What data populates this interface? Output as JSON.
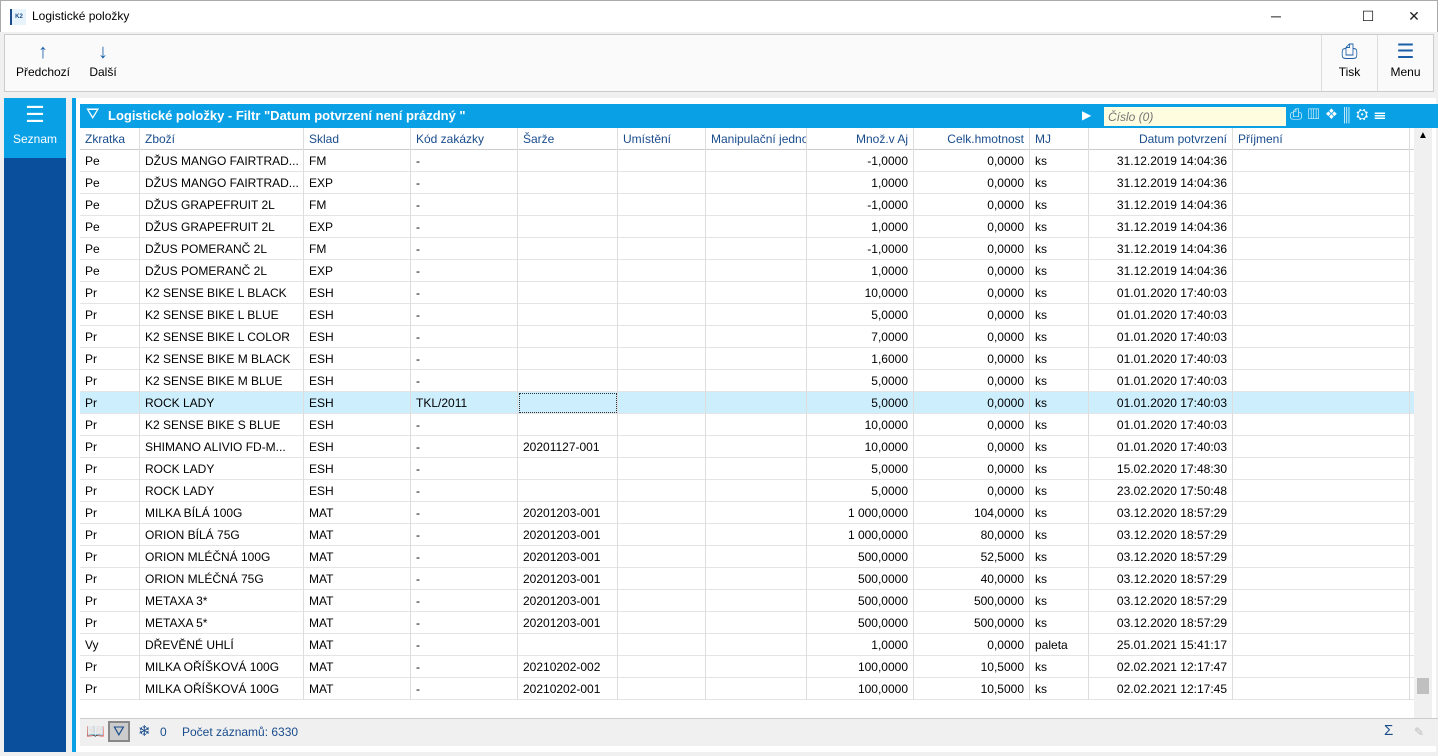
{
  "window": {
    "title": "Logistické položky",
    "logo": "K2"
  },
  "toolbar": {
    "prev": "Předchozí",
    "next": "Další",
    "print": "Tisk",
    "menu": "Menu"
  },
  "sidebar": {
    "active": "Seznam"
  },
  "panel": {
    "title": "Logistické položky - Filtr \"Datum potvrzení není prázdný \"",
    "search_placeholder": "Číslo (0)"
  },
  "columns": [
    "Zkratka",
    "Zboží",
    "Sklad",
    "Kód zakázky",
    "Šarže",
    "Umístění",
    "Manipulační jedno",
    "Množ.v Aj",
    "Celk.hmotnost",
    "MJ",
    "Datum potvrzení",
    "Příjmení"
  ],
  "rows": [
    [
      "Pe",
      "DŽUS MANGO FAIRTRAD...",
      "FM",
      "-",
      "",
      "",
      "",
      "-1,0000",
      "0,0000",
      "ks",
      "31.12.2019 14:04:36",
      ""
    ],
    [
      "Pe",
      "DŽUS MANGO FAIRTRAD...",
      "EXP",
      "-",
      "",
      "",
      "",
      "1,0000",
      "0,0000",
      "ks",
      "31.12.2019 14:04:36",
      ""
    ],
    [
      "Pe",
      "DŽUS GRAPEFRUIT 2L",
      "FM",
      "-",
      "",
      "",
      "",
      "-1,0000",
      "0,0000",
      "ks",
      "31.12.2019 14:04:36",
      ""
    ],
    [
      "Pe",
      "DŽUS GRAPEFRUIT 2L",
      "EXP",
      "-",
      "",
      "",
      "",
      "1,0000",
      "0,0000",
      "ks",
      "31.12.2019 14:04:36",
      ""
    ],
    [
      "Pe",
      "DŽUS POMERANČ 2L",
      "FM",
      "-",
      "",
      "",
      "",
      "-1,0000",
      "0,0000",
      "ks",
      "31.12.2019 14:04:36",
      ""
    ],
    [
      "Pe",
      "DŽUS POMERANČ 2L",
      "EXP",
      "-",
      "",
      "",
      "",
      "1,0000",
      "0,0000",
      "ks",
      "31.12.2019 14:04:36",
      ""
    ],
    [
      "Pr",
      "K2 SENSE BIKE L BLACK",
      "ESH",
      "-",
      "",
      "",
      "",
      "10,0000",
      "0,0000",
      "ks",
      "01.01.2020 17:40:03",
      ""
    ],
    [
      "Pr",
      "K2 SENSE BIKE L BLUE",
      "ESH",
      "-",
      "",
      "",
      "",
      "5,0000",
      "0,0000",
      "ks",
      "01.01.2020 17:40:03",
      ""
    ],
    [
      "Pr",
      "K2 SENSE BIKE L COLOR",
      "ESH",
      "-",
      "",
      "",
      "",
      "7,0000",
      "0,0000",
      "ks",
      "01.01.2020 17:40:03",
      ""
    ],
    [
      "Pr",
      "K2 SENSE BIKE M BLACK",
      "ESH",
      "-",
      "",
      "",
      "",
      "1,6000",
      "0,0000",
      "ks",
      "01.01.2020 17:40:03",
      ""
    ],
    [
      "Pr",
      "K2 SENSE BIKE M BLUE",
      "ESH",
      "-",
      "",
      "",
      "",
      "5,0000",
      "0,0000",
      "ks",
      "01.01.2020 17:40:03",
      ""
    ],
    [
      "Pr",
      "ROCK LADY",
      "ESH",
      "TKL/2011",
      "",
      "",
      "",
      "5,0000",
      "0,0000",
      "ks",
      "01.01.2020 17:40:03",
      ""
    ],
    [
      "Pr",
      "K2 SENSE BIKE S BLUE",
      "ESH",
      "-",
      "",
      "",
      "",
      "10,0000",
      "0,0000",
      "ks",
      "01.01.2020 17:40:03",
      ""
    ],
    [
      "Pr",
      "SHIMANO ALIVIO FD-M...",
      "ESH",
      "-",
      "20201127-001",
      "",
      "",
      "10,0000",
      "0,0000",
      "ks",
      "01.01.2020 17:40:03",
      ""
    ],
    [
      "Pr",
      "ROCK LADY",
      "ESH",
      "-",
      "",
      "",
      "",
      "5,0000",
      "0,0000",
      "ks",
      "15.02.2020 17:48:30",
      ""
    ],
    [
      "Pr",
      "ROCK LADY",
      "ESH",
      "-",
      "",
      "",
      "",
      "5,0000",
      "0,0000",
      "ks",
      "23.02.2020 17:50:48",
      ""
    ],
    [
      "Pr",
      "MILKA BÍLÁ 100G",
      "MAT",
      "-",
      "20201203-001",
      "",
      "",
      "1 000,0000",
      "104,0000",
      "ks",
      "03.12.2020 18:57:29",
      ""
    ],
    [
      "Pr",
      "ORION BÍLÁ 75G",
      "MAT",
      "-",
      "20201203-001",
      "",
      "",
      "1 000,0000",
      "80,0000",
      "ks",
      "03.12.2020 18:57:29",
      ""
    ],
    [
      "Pr",
      "ORION MLÉČNÁ 100G",
      "MAT",
      "-",
      "20201203-001",
      "",
      "",
      "500,0000",
      "52,5000",
      "ks",
      "03.12.2020 18:57:29",
      ""
    ],
    [
      "Pr",
      "ORION MLÉČNÁ 75G",
      "MAT",
      "-",
      "20201203-001",
      "",
      "",
      "500,0000",
      "40,0000",
      "ks",
      "03.12.2020 18:57:29",
      ""
    ],
    [
      "Pr",
      "METAXA 3*",
      "MAT",
      "-",
      "20201203-001",
      "",
      "",
      "500,0000",
      "500,0000",
      "ks",
      "03.12.2020 18:57:29",
      ""
    ],
    [
      "Pr",
      "METAXA 5*",
      "MAT",
      "-",
      "20201203-001",
      "",
      "",
      "500,0000",
      "500,0000",
      "ks",
      "03.12.2020 18:57:29",
      ""
    ],
    [
      "Vy",
      "DŘEVĚNÉ UHLÍ",
      "MAT",
      "-",
      "",
      "",
      "",
      "1,0000",
      "0,0000",
      "paleta",
      "25.01.2021 15:41:17",
      ""
    ],
    [
      "Pr",
      "MILKA OŘÍŠKOVÁ 100G",
      "MAT",
      "-",
      "20210202-002",
      "",
      "",
      "100,0000",
      "10,5000",
      "ks",
      "02.02.2021 12:17:47",
      ""
    ],
    [
      "Pr",
      "MILKA OŘÍŠKOVÁ 100G",
      "MAT",
      "-",
      "20210202-001",
      "",
      "",
      "100,0000",
      "10,5000",
      "ks",
      "02.02.2021 12:17:45",
      ""
    ]
  ],
  "selected_row": 11,
  "status": {
    "marked": "0",
    "count": "Počet záznamů: 6330"
  },
  "colors": {
    "accent": "#0aa0e6",
    "sidebar": "#0a4f9c",
    "selected": "#cdeefd"
  }
}
